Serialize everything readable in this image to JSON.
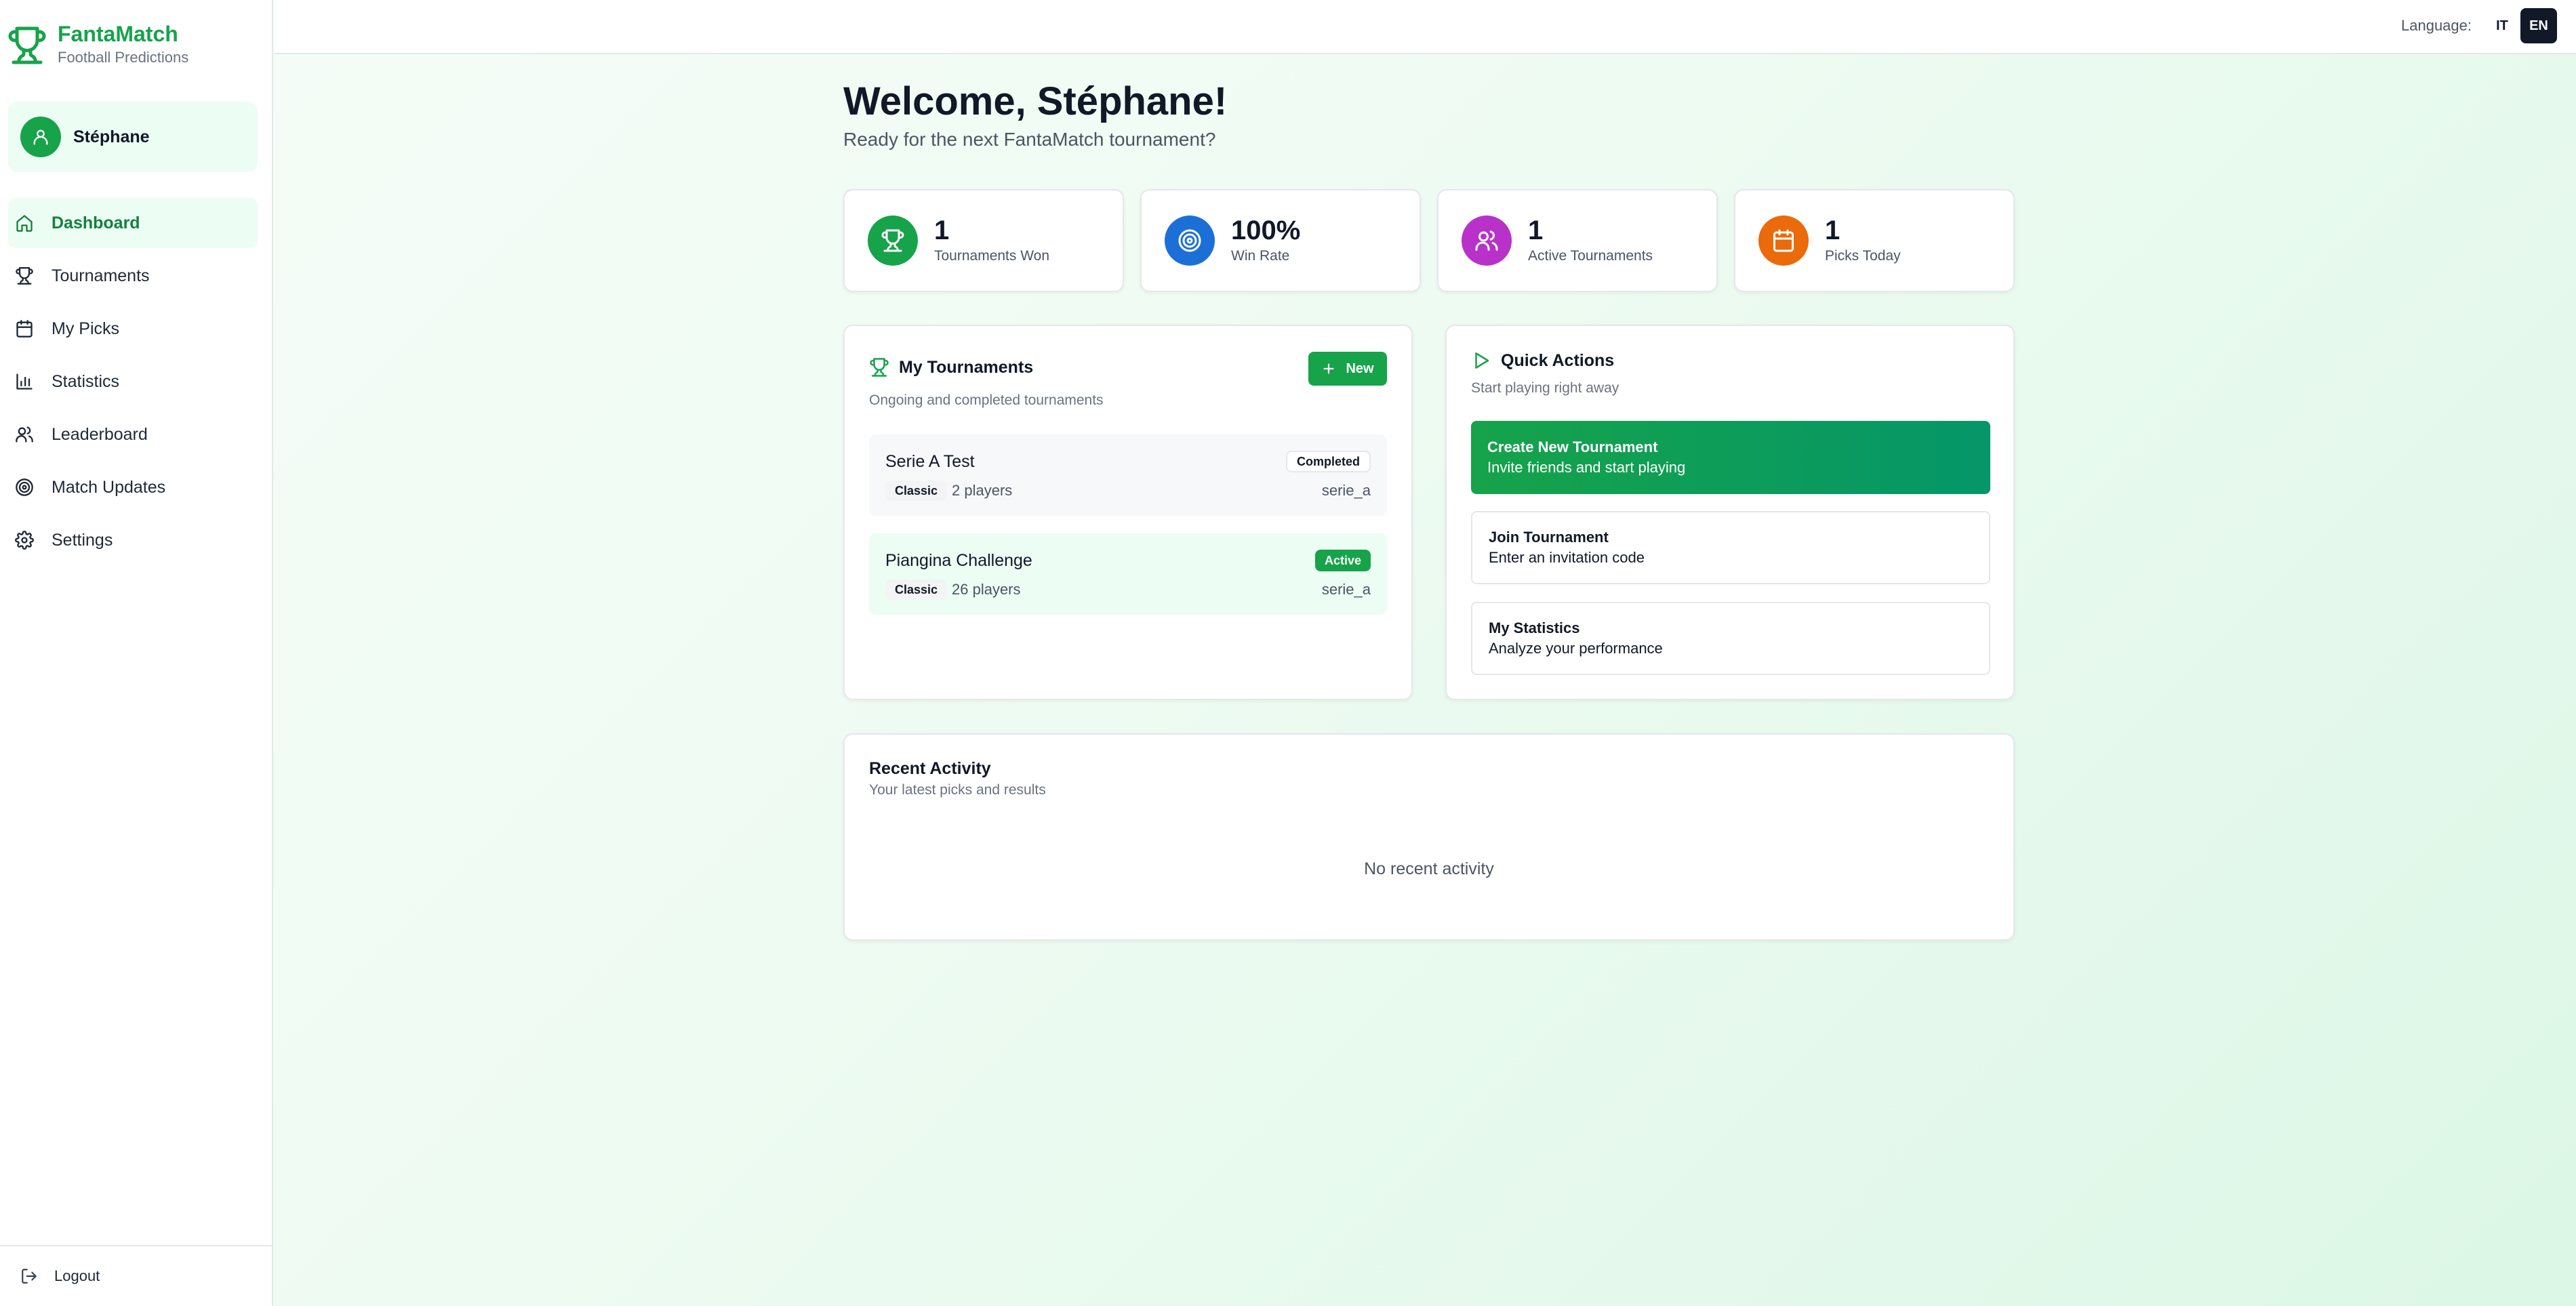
{
  "brand": {
    "title": "FantaMatch",
    "subtitle": "Football Predictions",
    "color": "#16a34a"
  },
  "user": {
    "name": "Stéphane"
  },
  "nav": {
    "items": [
      {
        "label": "Dashboard",
        "icon": "home-icon",
        "active": true
      },
      {
        "label": "Tournaments",
        "icon": "trophy-icon"
      },
      {
        "label": "My Picks",
        "icon": "calendar-icon"
      },
      {
        "label": "Statistics",
        "icon": "bar-chart-icon"
      },
      {
        "label": "Leaderboard",
        "icon": "users-icon"
      },
      {
        "label": "Match Updates",
        "icon": "target-icon"
      },
      {
        "label": "Settings",
        "icon": "gear-icon"
      }
    ],
    "logout": "Logout"
  },
  "topbar": {
    "language_label": "Language:",
    "languages": [
      "IT",
      "EN"
    ],
    "selected": "EN"
  },
  "welcome": {
    "title": "Welcome, Stéphane!",
    "subtitle": "Ready for the next FantaMatch tournament?"
  },
  "stats": [
    {
      "value": "1",
      "label": "Tournaments Won",
      "icon": "trophy-icon",
      "color": "#16a34a"
    },
    {
      "value": "100%",
      "label": "Win Rate",
      "icon": "target-icon",
      "color": "#1d6fd8"
    },
    {
      "value": "1",
      "label": "Active Tournaments",
      "icon": "users-icon",
      "color": "#b832c9"
    },
    {
      "value": "1",
      "label": "Picks Today",
      "icon": "calendar-icon",
      "color": "#ea6a0c"
    }
  ],
  "my_tournaments": {
    "title": "My Tournaments",
    "subtitle": "Ongoing and completed tournaments",
    "new_label": "New",
    "items": [
      {
        "name": "Serie A Test",
        "type": "Classic",
        "players": "2 players",
        "status": "Completed",
        "league": "serie_a"
      },
      {
        "name": "Piangina Challenge",
        "type": "Classic",
        "players": "26 players",
        "status": "Active",
        "league": "serie_a"
      }
    ]
  },
  "quick_actions": {
    "title": "Quick Actions",
    "subtitle": "Start playing right away",
    "items": [
      {
        "title": "Create New Tournament",
        "desc": "Invite friends and start playing"
      },
      {
        "title": "Join Tournament",
        "desc": "Enter an invitation code"
      },
      {
        "title": "My Statistics",
        "desc": "Analyze your performance"
      }
    ]
  },
  "recent_activity": {
    "title": "Recent Activity",
    "subtitle": "Your latest picks and results",
    "empty": "No recent activity"
  }
}
